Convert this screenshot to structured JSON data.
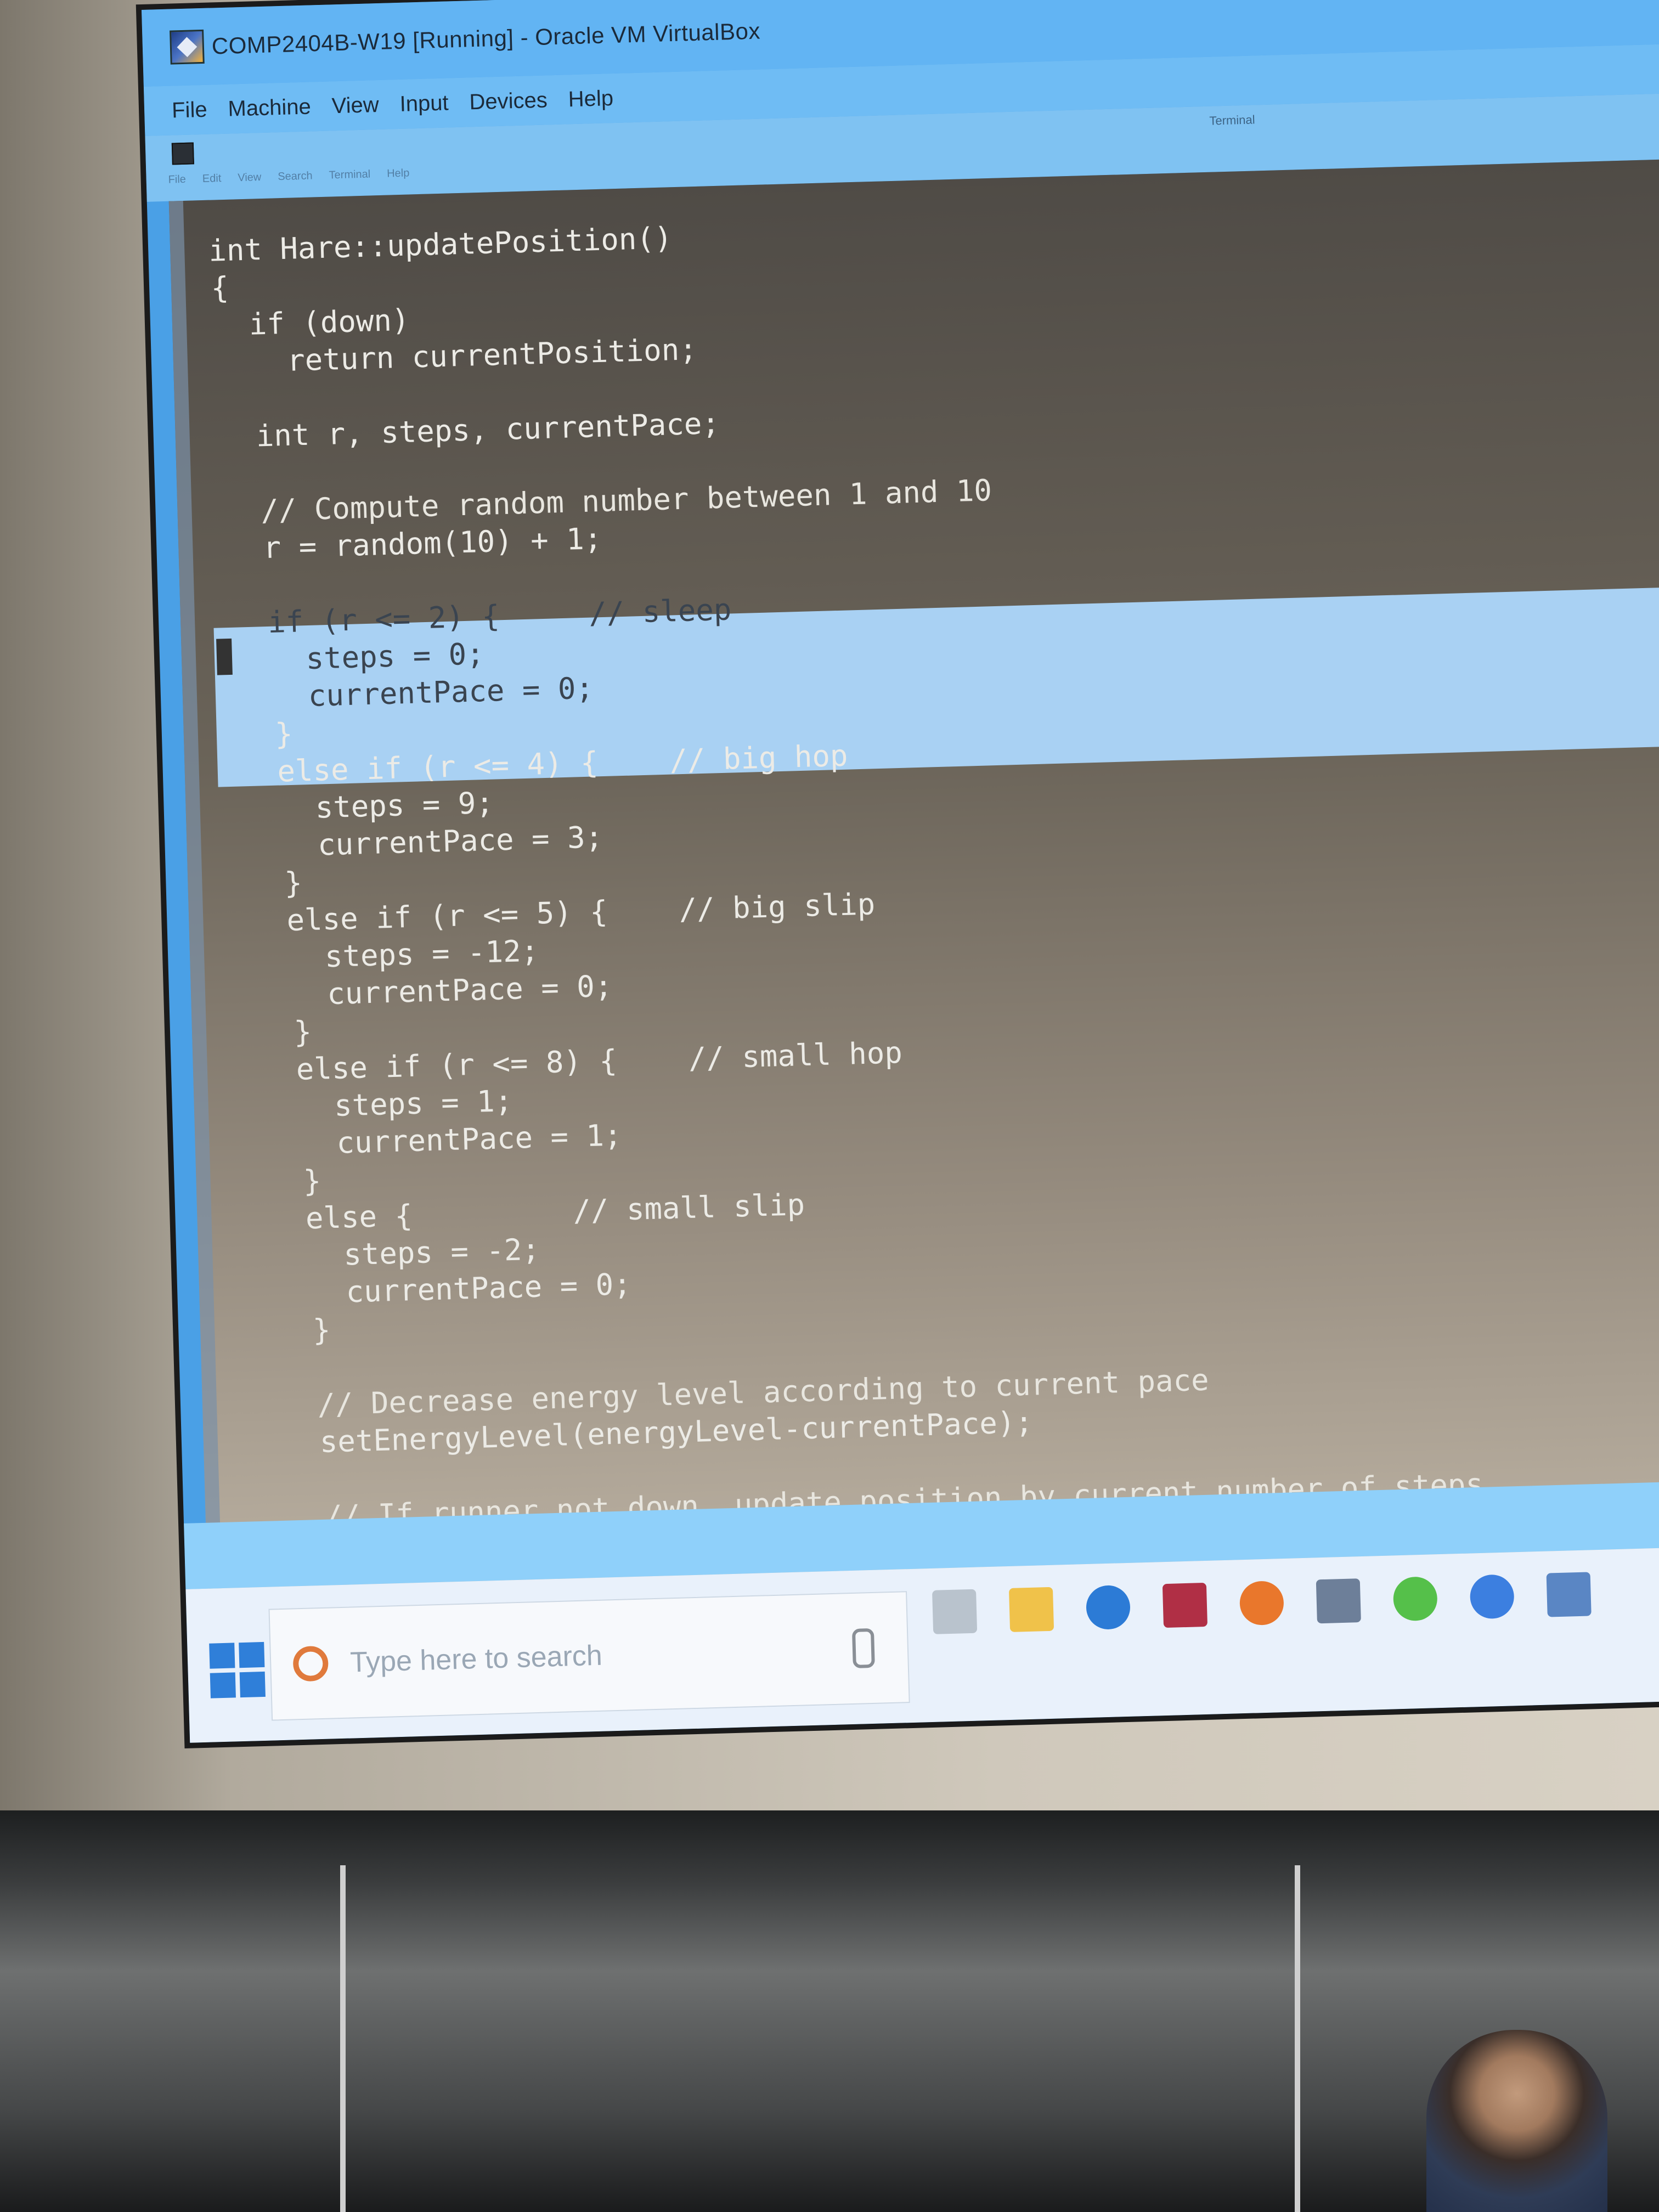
{
  "window": {
    "title": "COMP2404B-W19 [Running] - Oracle VM VirtualBox",
    "icon": "virtualbox-icon"
  },
  "menubar": {
    "items": [
      "File",
      "Machine",
      "View",
      "Input",
      "Devices",
      "Help"
    ]
  },
  "guest_terminal": {
    "title": "Terminal",
    "menu": [
      "File",
      "Edit",
      "View",
      "Search",
      "Terminal",
      "Help"
    ]
  },
  "code": {
    "lines": [
      "int Hare::updatePosition()",
      "{",
      "  if (down)",
      "    return currentPosition;",
      "",
      "  int r, steps, currentPace;",
      "",
      "  // Compute random number between 1 and 10",
      "  r = random(10) + 1;",
      "",
      "  if (r <= 2) {     // sleep",
      "    steps = 0;",
      "    currentPace = 0;",
      "  }",
      "  else if (r <= 4) {    // big hop",
      "    steps = 9;",
      "    currentPace = 3;",
      "  }",
      "  else if (r <= 5) {    // big slip",
      "    steps = -12;",
      "    currentPace = 0;",
      "  }",
      "  else if (r <= 8) {    // small hop",
      "    steps = 1;",
      "    currentPace = 1;",
      "  }",
      "  else {         // small slip",
      "    steps = -2;",
      "    currentPace = 0;",
      "  }",
      "",
      "  // Decrease energy level according to current pace",
      "  setEnergyLevel(energyLevel-currentPace);",
      "",
      "  // If runner not down, update position by current number of steps"
    ],
    "highlighted_lines": [
      10,
      11,
      12
    ]
  },
  "taskbar": {
    "search_placeholder": "Type here to search",
    "icons": [
      "task-view-icon",
      "file-explorer-icon",
      "edge-icon",
      "onenote-icon",
      "firefox-icon",
      "virtualbox-taskbar-icon",
      "sync-icon",
      "chrome-icon",
      "app-icon"
    ]
  },
  "colors": {
    "titlebar": "#62b4f3",
    "terminal_bg": "#4f4b46",
    "code_text": "#ecebe6",
    "selection": "#a9d1f3"
  }
}
